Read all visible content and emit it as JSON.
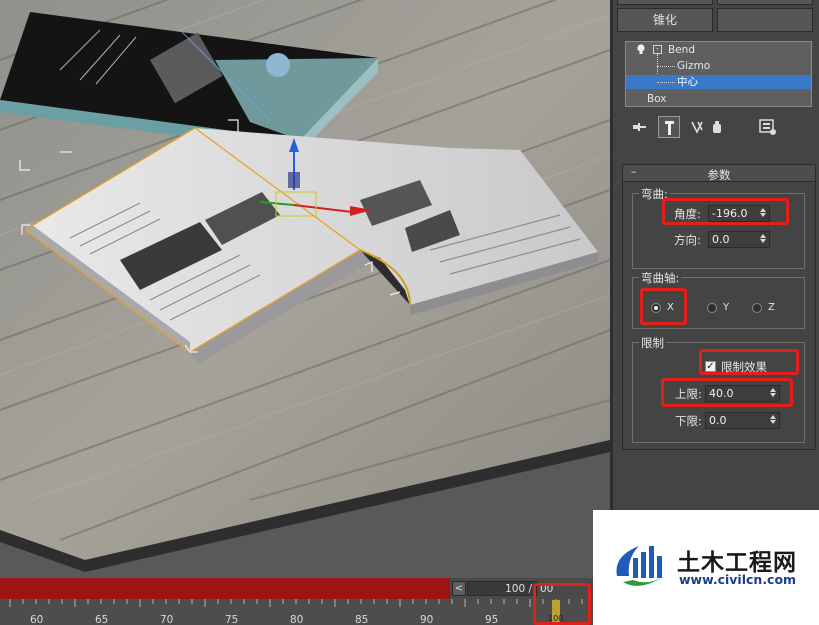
{
  "command_panel": {
    "collapse_button": "锥化",
    "modifier_stack": {
      "items": [
        {
          "label": "Bend"
        },
        {
          "label": "Gizmo"
        },
        {
          "label": "中心"
        },
        {
          "label": "Box"
        }
      ]
    },
    "parameters": {
      "title": "参数",
      "collapse_symbol": "–",
      "bend_group": {
        "title": "弯曲:",
        "angle_label": "角度:",
        "angle_value": "-196.0",
        "direction_label": "方向:",
        "direction_value": "0.0"
      },
      "axis_group": {
        "title": "弯曲轴:",
        "options": [
          {
            "label": "X",
            "selected": true
          },
          {
            "label": "Y",
            "selected": false
          },
          {
            "label": "Z",
            "selected": false
          }
        ]
      },
      "limits_group": {
        "title": "限制",
        "limit_effect_label": "限制效果",
        "limit_effect_checked": true,
        "upper_label": "上限:",
        "upper_value": "40.0",
        "lower_label": "下限:",
        "lower_value": "0.0"
      }
    }
  },
  "timeline": {
    "prev_symbol": "<",
    "current_frame_text": "100 /",
    "end_frame_text": "00",
    "ticks": [
      "60",
      "65",
      "70",
      "75",
      "80",
      "85",
      "90",
      "95"
    ],
    "key_label": "100"
  },
  "watermark": {
    "name": "土木工程网",
    "url": "www.civilcn.com"
  },
  "colors": {
    "highlight": "#e0201b",
    "selection": "#3a78c8",
    "time_slider": "#9d1414"
  }
}
